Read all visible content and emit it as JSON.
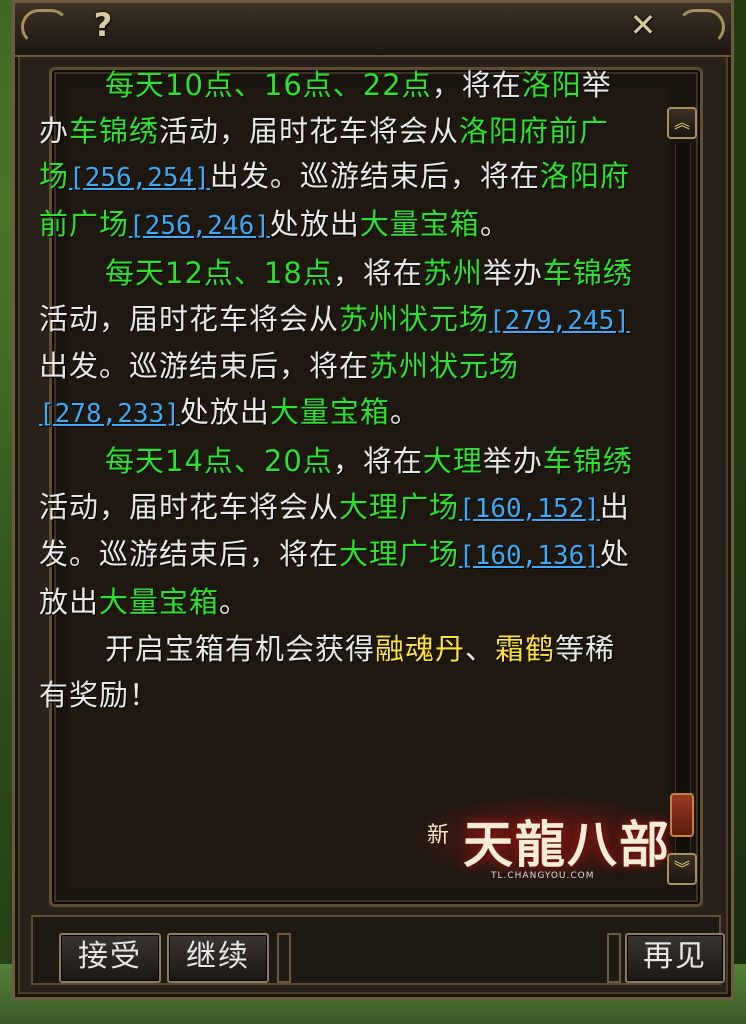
{
  "window": {
    "help_label": "?",
    "close_label": "✕"
  },
  "paragraphs": [
    [
      {
        "t": "每天10点、16点、22点",
        "s": "g"
      },
      {
        "t": "，将在",
        "s": "w"
      },
      {
        "t": "洛阳",
        "s": "g"
      },
      {
        "t": "举办",
        "s": "w"
      },
      {
        "t": "车锦绣",
        "s": "g"
      },
      {
        "t": "活动，届时花车将会从",
        "s": "w"
      },
      {
        "t": "洛阳府前广场",
        "s": "g"
      },
      {
        "t": "[256,254]",
        "s": "c"
      },
      {
        "t": "出发。巡游结束后，将在",
        "s": "w"
      },
      {
        "t": "洛阳府前广场",
        "s": "g"
      },
      {
        "t": "[256,246]",
        "s": "c"
      },
      {
        "t": "处放出",
        "s": "w"
      },
      {
        "t": "大量宝箱",
        "s": "g"
      },
      {
        "t": "。",
        "s": "w"
      }
    ],
    [
      {
        "t": "每天12点、18点",
        "s": "g"
      },
      {
        "t": "，将在",
        "s": "w"
      },
      {
        "t": "苏州",
        "s": "g"
      },
      {
        "t": "举办",
        "s": "w"
      },
      {
        "t": "车锦绣",
        "s": "g"
      },
      {
        "t": "活动，届时花车将会从",
        "s": "w"
      },
      {
        "t": "苏州状元场",
        "s": "g"
      },
      {
        "t": "[279,245]",
        "s": "c"
      },
      {
        "t": "出发。巡游结束后，将在",
        "s": "w"
      },
      {
        "t": "苏州状元场",
        "s": "g"
      },
      {
        "t": "[278,233]",
        "s": "c"
      },
      {
        "t": "处放出",
        "s": "w"
      },
      {
        "t": "大量宝箱",
        "s": "g"
      },
      {
        "t": "。",
        "s": "w"
      }
    ],
    [
      {
        "t": "每天14点、20点",
        "s": "g"
      },
      {
        "t": "，将在",
        "s": "w"
      },
      {
        "t": "大理",
        "s": "g"
      },
      {
        "t": "举办",
        "s": "w"
      },
      {
        "t": "车锦绣",
        "s": "g"
      },
      {
        "t": "活动，届时花车将会从",
        "s": "w"
      },
      {
        "t": "大理广场",
        "s": "g"
      },
      {
        "t": "[160,152]",
        "s": "c"
      },
      {
        "t": "出发。巡游结束后，将在",
        "s": "w"
      },
      {
        "t": "大理广场",
        "s": "g"
      },
      {
        "t": "[160,136]",
        "s": "c"
      },
      {
        "t": "处放出",
        "s": "w"
      },
      {
        "t": "大量宝箱",
        "s": "g"
      },
      {
        "t": "。",
        "s": "w"
      }
    ],
    [
      {
        "t": "开启宝箱有机会获得",
        "s": "w"
      },
      {
        "t": "融魂丹",
        "s": "y"
      },
      {
        "t": "、",
        "s": "w"
      },
      {
        "t": "霜鹤",
        "s": "y"
      },
      {
        "t": "等稀有奖励！",
        "s": "w"
      }
    ]
  ],
  "scroll": {
    "up_icon": "︽",
    "down_icon": "︾"
  },
  "logo": {
    "prefix": "新",
    "title": "天龍八部",
    "url": "TL.CHANGYOU.COM"
  },
  "buttons": {
    "accept": "接受",
    "continue": "继续",
    "goodbye": "再见"
  }
}
